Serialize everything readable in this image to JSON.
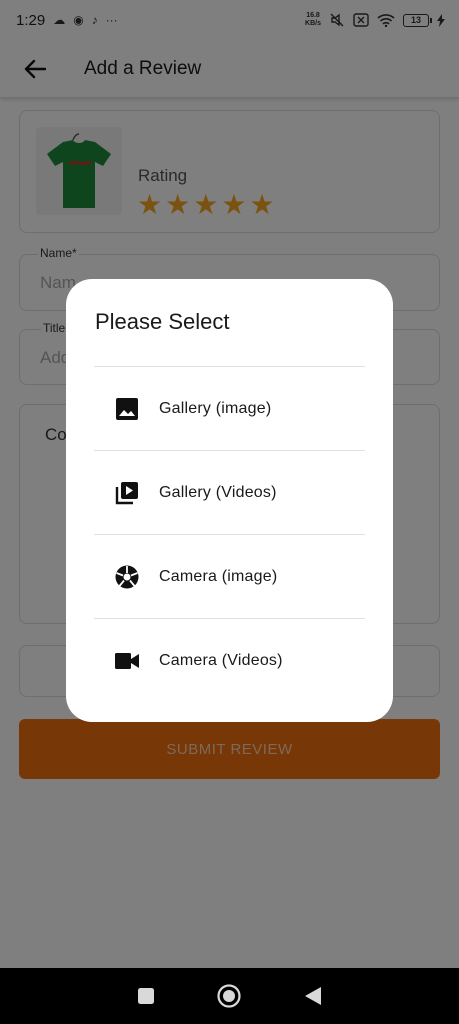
{
  "status_bar": {
    "time": "1:29",
    "more": "···",
    "speed_top": "16.8",
    "speed_bottom": "KB/s",
    "battery": "13"
  },
  "app_bar": {
    "title": "Add a Review"
  },
  "review": {
    "rating_label": "Rating",
    "rating_value": 5,
    "stars": [
      "★",
      "★",
      "★",
      "★",
      "★"
    ],
    "name_label": "Name*",
    "name_placeholder": "Nam",
    "title_label": "Title",
    "title_placeholder": "Add",
    "comment_placeholder": "Co",
    "submit_label": "SUBMIT REVIEW"
  },
  "dialog": {
    "title": "Please Select",
    "options": [
      {
        "label": "Gallery (image)",
        "icon": "image-icon"
      },
      {
        "label": "Gallery (Videos)",
        "icon": "video-library-icon"
      },
      {
        "label": "Camera (image)",
        "icon": "camera-shutter-icon"
      },
      {
        "label": "Camera (Videos)",
        "icon": "videocam-icon"
      }
    ]
  },
  "colors": {
    "accent": "#ee6e0c",
    "star": "#f6a623",
    "product_shirt": "#1f8a3a"
  }
}
